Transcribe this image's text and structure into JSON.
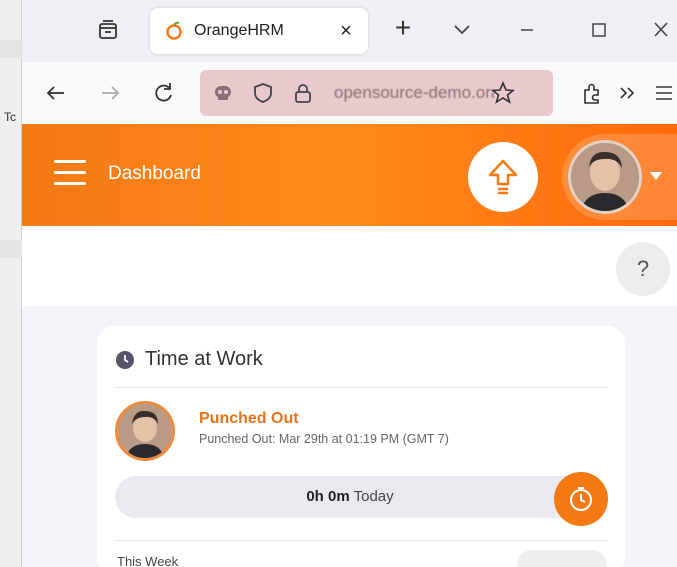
{
  "side_window": {
    "label": "Tc"
  },
  "browser": {
    "tab": {
      "title": "OrangeHRM",
      "close": "×"
    },
    "new_tab": "+",
    "url": "opensource-demo.orangehrmlive.com"
  },
  "app": {
    "header_title": "Dashboard",
    "help": "?",
    "card": {
      "title": "Time at Work",
      "status": "Punched Out",
      "status_detail": "Punched Out: Mar 29th at 01:19 PM (GMT 7)",
      "today_value": "0h 0m",
      "today_label": "Today",
      "week_label": "This Week"
    }
  },
  "colors": {
    "brand": "#f47a14",
    "status": "#e6731c",
    "url_bg": "#e9c9cc"
  }
}
